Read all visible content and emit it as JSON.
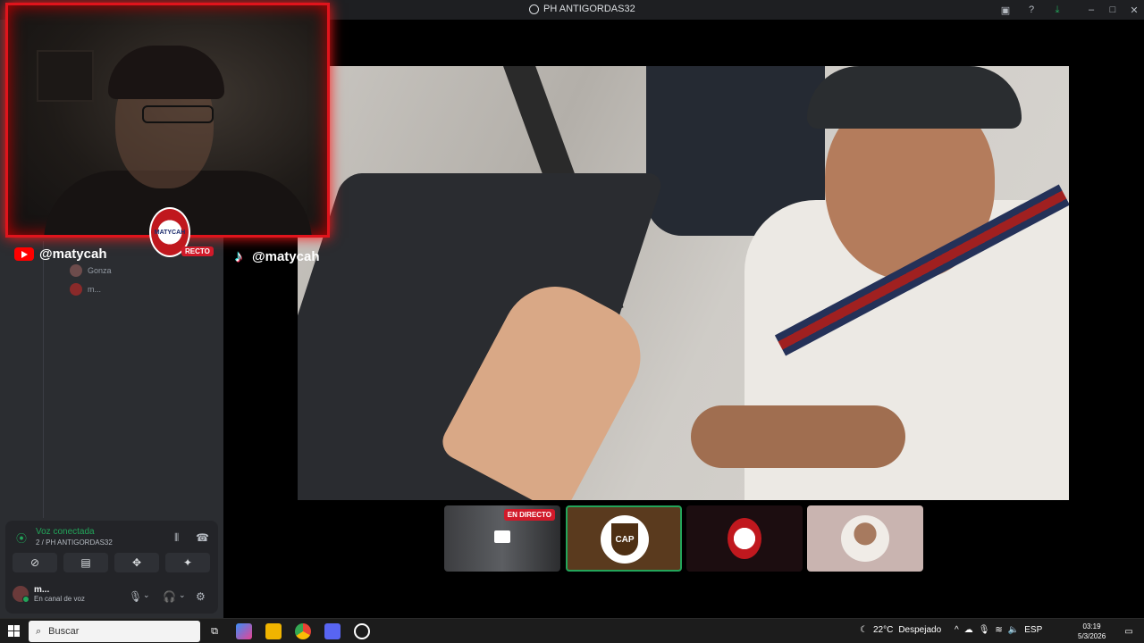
{
  "window": {
    "title": "PH ANTIGORDAS32"
  },
  "webcam": {
    "badge_label": "MATYCAH",
    "live_label": "RECTO"
  },
  "socials": {
    "youtube_handle": "@matycah",
    "tiktok_handle": "@matycah"
  },
  "voice_channel_users": [
    {
      "name": "Gonza"
    },
    {
      "name": "m..."
    }
  ],
  "thumbnails": {
    "live_badge": "EN DIRECTO",
    "cap_label": "CAP"
  },
  "voice_panel": {
    "status": "Voz conectada",
    "channel": "2 / PH ANTIGORDAS32",
    "user_name": "m...",
    "user_status": "En canal de voz"
  },
  "taskbar": {
    "search_placeholder": "Buscar",
    "temperature": "22°C",
    "weather": "Despejado",
    "language": "ESP",
    "time": "03:19",
    "date": "5/3/2026"
  },
  "colors": {
    "accent_green": "#23a55a",
    "live_red": "#d11a2a",
    "cam_border": "#e0141c"
  }
}
